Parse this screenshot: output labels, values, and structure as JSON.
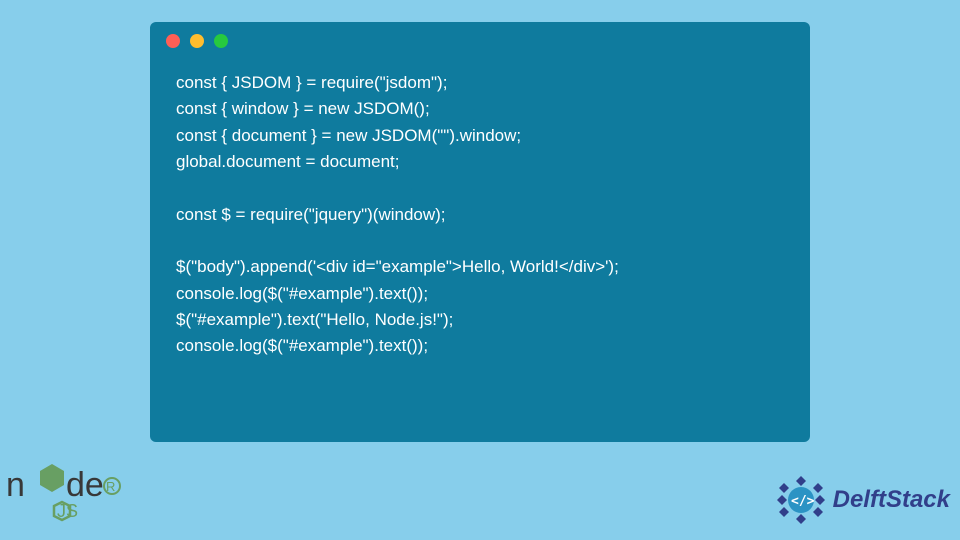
{
  "code": {
    "line1": "const { JSDOM } = require(\"jsdom\");",
    "line2": "const { window } = new JSDOM();",
    "line3": "const { document } = new JSDOM(\"\").window;",
    "line4": "global.document = document;",
    "line5": "",
    "line6": "const $ = require(\"jquery\")(window);",
    "line7": "",
    "line8": "$(\"body\").append('<div id=\"example\">Hello, World!</div>');",
    "line9": "console.log($(\"#example\").text());",
    "line10": "$(\"#example\").text(\"Hello, Node.js!\");",
    "line11": "console.log($(\"#example\").text());"
  },
  "logos": {
    "node": "node",
    "delft": "DelftStack"
  },
  "colors": {
    "background": "#87ceeb",
    "window": "#0f7b9e",
    "text": "#ffffff",
    "node_green": "#689f63",
    "delft_blue": "#313f8a"
  }
}
